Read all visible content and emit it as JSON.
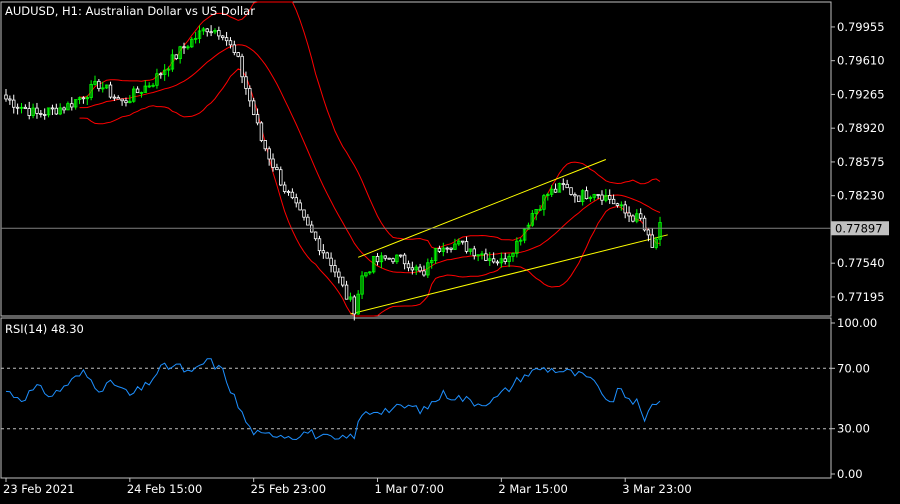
{
  "colors": {
    "background": "#000000",
    "frame": "#c0c0c0",
    "text": "#ffffff",
    "bull_candle": "#00ff00",
    "bear_candle": "#ffffff",
    "bollinger": "#ff0000",
    "channel": "#ffff00",
    "rsi_line": "#1e90ff",
    "rsi_levels": "#c0c0c0",
    "price_line": "#808080",
    "price_tag_bg": "#c0c0c0",
    "price_tag_text": "#000000"
  },
  "chart_data": [
    {
      "type": "candlestick",
      "title": "AUDUSD, H1:  Australian Dollar vs US Dollar",
      "y_ticks": [
        "0.79955",
        "0.79610",
        "0.79265",
        "0.78920",
        "0.78575",
        "0.78230",
        "0.77540",
        "0.77195"
      ],
      "current_price": "0.77897",
      "ylim": [
        0.77,
        0.8021
      ],
      "indicators": [
        "Bollinger Bands",
        "Trend channel"
      ],
      "close_anchors": [
        [
          0,
          0.7922
        ],
        [
          8,
          0.7906
        ],
        [
          16,
          0.7915
        ],
        [
          24,
          0.7937
        ],
        [
          30,
          0.7918
        ],
        [
          38,
          0.794
        ],
        [
          46,
          0.7975
        ],
        [
          52,
          0.7995
        ],
        [
          56,
          0.799
        ],
        [
          60,
          0.796
        ],
        [
          66,
          0.788
        ],
        [
          72,
          0.783
        ],
        [
          78,
          0.779
        ],
        [
          84,
          0.7755
        ],
        [
          88,
          0.772
        ],
        [
          90,
          0.7708
        ],
        [
          92,
          0.774
        ],
        [
          95,
          0.7755
        ],
        [
          100,
          0.776
        ],
        [
          104,
          0.7755
        ],
        [
          108,
          0.774
        ],
        [
          110,
          0.776
        ],
        [
          113,
          0.7775
        ],
        [
          118,
          0.7772
        ],
        [
          124,
          0.7762
        ],
        [
          128,
          0.7755
        ],
        [
          132,
          0.7775
        ],
        [
          136,
          0.7805
        ],
        [
          140,
          0.7825
        ],
        [
          144,
          0.7832
        ],
        [
          148,
          0.7822
        ],
        [
          152,
          0.7828
        ],
        [
          156,
          0.782
        ],
        [
          160,
          0.7805
        ],
        [
          164,
          0.7798
        ],
        [
          167,
          0.7768
        ],
        [
          169,
          0.779
        ]
      ]
    },
    {
      "type": "line",
      "title": "RSI(14) 48.30",
      "y_ticks": [
        "100.00",
        "70.00",
        "30.00",
        "0.00"
      ],
      "levels": [
        70,
        30
      ],
      "ylim": [
        0,
        100
      ],
      "last_value": 48.3,
      "rsi_anchors": [
        [
          0,
          55
        ],
        [
          4,
          50
        ],
        [
          8,
          57
        ],
        [
          12,
          52
        ],
        [
          16,
          60
        ],
        [
          20,
          67
        ],
        [
          24,
          57
        ],
        [
          28,
          60
        ],
        [
          32,
          52
        ],
        [
          36,
          58
        ],
        [
          40,
          70
        ],
        [
          44,
          72
        ],
        [
          48,
          66
        ],
        [
          52,
          76
        ],
        [
          56,
          68
        ],
        [
          60,
          45
        ],
        [
          63,
          30
        ],
        [
          66,
          25
        ],
        [
          70,
          27
        ],
        [
          74,
          25
        ],
        [
          78,
          28
        ],
        [
          82,
          24
        ],
        [
          86,
          22
        ],
        [
          90,
          26
        ],
        [
          92,
          39
        ],
        [
          95,
          42
        ],
        [
          100,
          43
        ],
        [
          104,
          45
        ],
        [
          108,
          42
        ],
        [
          110,
          47
        ],
        [
          113,
          53
        ],
        [
          118,
          50
        ],
        [
          122,
          47
        ],
        [
          126,
          49
        ],
        [
          130,
          57
        ],
        [
          133,
          64
        ],
        [
          138,
          70
        ],
        [
          142,
          69
        ],
        [
          146,
          67
        ],
        [
          150,
          64
        ],
        [
          154,
          55
        ],
        [
          156,
          45
        ],
        [
          158,
          55
        ],
        [
          160,
          52
        ],
        [
          163,
          47
        ],
        [
          165,
          34
        ],
        [
          167,
          48
        ],
        [
          169,
          48
        ]
      ]
    }
  ],
  "x_axis": {
    "labels": [
      {
        "text": "23 Feb 2021",
        "bar": 0
      },
      {
        "text": "24 Feb 15:00",
        "bar": 32
      },
      {
        "text": "25 Feb 23:00",
        "bar": 64
      },
      {
        "text": "1 Mar 07:00",
        "bar": 96
      },
      {
        "text": "2 Mar 15:00",
        "bar": 128
      },
      {
        "text": "3 Mar 23:00",
        "bar": 160
      }
    ]
  }
}
